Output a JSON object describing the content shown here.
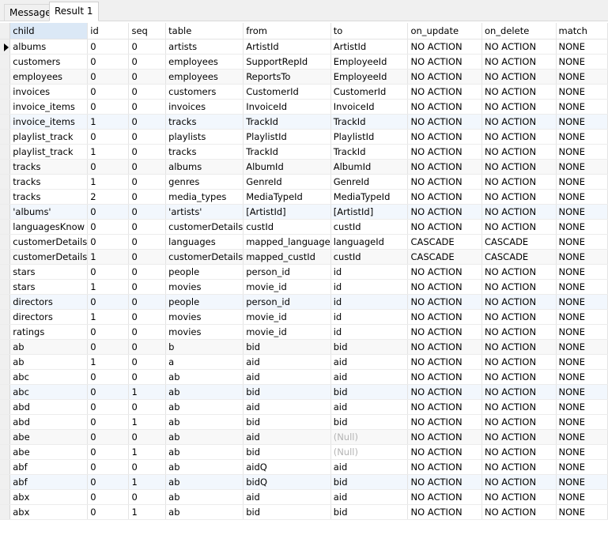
{
  "tabs": [
    {
      "label": "Message",
      "active": false
    },
    {
      "label": "Result 1",
      "active": true
    }
  ],
  "grid": {
    "columns": [
      "child",
      "id",
      "seq",
      "table",
      "from",
      "to",
      "on_update",
      "on_delete",
      "match"
    ],
    "sorted_column": "child",
    "current_row": 0,
    "null_text": "(Null)",
    "rows": [
      [
        "albums",
        "0",
        "0",
        "artists",
        "ArtistId",
        "ArtistId",
        "NO ACTION",
        "NO ACTION",
        "NONE"
      ],
      [
        "customers",
        "0",
        "0",
        "employees",
        "SupportRepId",
        "EmployeeId",
        "NO ACTION",
        "NO ACTION",
        "NONE"
      ],
      [
        "employees",
        "0",
        "0",
        "employees",
        "ReportsTo",
        "EmployeeId",
        "NO ACTION",
        "NO ACTION",
        "NONE"
      ],
      [
        "invoices",
        "0",
        "0",
        "customers",
        "CustomerId",
        "CustomerId",
        "NO ACTION",
        "NO ACTION",
        "NONE"
      ],
      [
        "invoice_items",
        "0",
        "0",
        "invoices",
        "InvoiceId",
        "InvoiceId",
        "NO ACTION",
        "NO ACTION",
        "NONE"
      ],
      [
        "invoice_items",
        "1",
        "0",
        "tracks",
        "TrackId",
        "TrackId",
        "NO ACTION",
        "NO ACTION",
        "NONE"
      ],
      [
        "playlist_track",
        "0",
        "0",
        "playlists",
        "PlaylistId",
        "PlaylistId",
        "NO ACTION",
        "NO ACTION",
        "NONE"
      ],
      [
        "playlist_track",
        "1",
        "0",
        "tracks",
        "TrackId",
        "TrackId",
        "NO ACTION",
        "NO ACTION",
        "NONE"
      ],
      [
        "tracks",
        "0",
        "0",
        "albums",
        "AlbumId",
        "AlbumId",
        "NO ACTION",
        "NO ACTION",
        "NONE"
      ],
      [
        "tracks",
        "1",
        "0",
        "genres",
        "GenreId",
        "GenreId",
        "NO ACTION",
        "NO ACTION",
        "NONE"
      ],
      [
        "tracks",
        "2",
        "0",
        "media_types",
        "MediaTypeId",
        "MediaTypeId",
        "NO ACTION",
        "NO ACTION",
        "NONE"
      ],
      [
        "'albums'",
        "0",
        "0",
        "'artists'",
        "[ArtistId]",
        "[ArtistId]",
        "NO ACTION",
        "NO ACTION",
        "NONE"
      ],
      [
        "languagesKnow",
        "0",
        "0",
        "customerDetails",
        "custId",
        "custId",
        "NO ACTION",
        "NO ACTION",
        "NONE"
      ],
      [
        "customerDetails",
        "0",
        "0",
        "languages",
        "mapped_language",
        "languageId",
        "CASCADE",
        "CASCADE",
        "NONE"
      ],
      [
        "customerDetails",
        "1",
        "0",
        "customerDetails",
        "mapped_custId",
        "custId",
        "CASCADE",
        "CASCADE",
        "NONE"
      ],
      [
        "stars",
        "0",
        "0",
        "people",
        "person_id",
        "id",
        "NO ACTION",
        "NO ACTION",
        "NONE"
      ],
      [
        "stars",
        "1",
        "0",
        "movies",
        "movie_id",
        "id",
        "NO ACTION",
        "NO ACTION",
        "NONE"
      ],
      [
        "directors",
        "0",
        "0",
        "people",
        "person_id",
        "id",
        "NO ACTION",
        "NO ACTION",
        "NONE"
      ],
      [
        "directors",
        "1",
        "0",
        "movies",
        "movie_id",
        "id",
        "NO ACTION",
        "NO ACTION",
        "NONE"
      ],
      [
        "ratings",
        "0",
        "0",
        "movies",
        "movie_id",
        "id",
        "NO ACTION",
        "NO ACTION",
        "NONE"
      ],
      [
        "ab",
        "0",
        "0",
        "b",
        "bid",
        "bid",
        "NO ACTION",
        "NO ACTION",
        "NONE"
      ],
      [
        "ab",
        "1",
        "0",
        "a",
        "aid",
        "aid",
        "NO ACTION",
        "NO ACTION",
        "NONE"
      ],
      [
        "abc",
        "0",
        "0",
        "ab",
        "aid",
        "aid",
        "NO ACTION",
        "NO ACTION",
        "NONE"
      ],
      [
        "abc",
        "0",
        "1",
        "ab",
        "bid",
        "bid",
        "NO ACTION",
        "NO ACTION",
        "NONE"
      ],
      [
        "abd",
        "0",
        "0",
        "ab",
        "aid",
        "aid",
        "NO ACTION",
        "NO ACTION",
        "NONE"
      ],
      [
        "abd",
        "0",
        "1",
        "ab",
        "bid",
        "bid",
        "NO ACTION",
        "NO ACTION",
        "NONE"
      ],
      [
        "abe",
        "0",
        "0",
        "ab",
        "aid",
        null,
        "NO ACTION",
        "NO ACTION",
        "NONE"
      ],
      [
        "abe",
        "0",
        "1",
        "ab",
        "bid",
        null,
        "NO ACTION",
        "NO ACTION",
        "NONE"
      ],
      [
        "abf",
        "0",
        "0",
        "ab",
        "aidQ",
        "aid",
        "NO ACTION",
        "NO ACTION",
        "NONE"
      ],
      [
        "abf",
        "0",
        "1",
        "ab",
        "bidQ",
        "bid",
        "NO ACTION",
        "NO ACTION",
        "NONE"
      ],
      [
        "abx",
        "0",
        "0",
        "ab",
        "aid",
        "aid",
        "NO ACTION",
        "NO ACTION",
        "NONE"
      ],
      [
        "abx",
        "0",
        "1",
        "ab",
        "bid",
        "bid",
        "NO ACTION",
        "NO ACTION",
        "NONE"
      ]
    ]
  },
  "colors": {
    "sorted_header": "#dbe8f6",
    "alt_row": "#f8f8f8",
    "highlight_row": "#f2f7fd",
    "null_text": "#b4b4b4"
  }
}
